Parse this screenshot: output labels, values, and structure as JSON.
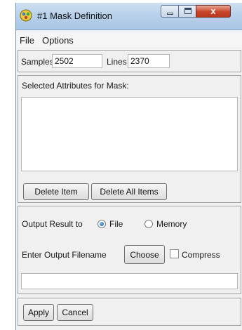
{
  "window": {
    "title": "#1 Mask Definition",
    "close_glyph": "x",
    "icons": {
      "app": "app-icon",
      "minimize": "minimize-icon",
      "maximize": "maximize-icon",
      "close": "close-icon"
    }
  },
  "menu": {
    "file": "File",
    "options": "Options"
  },
  "dims": {
    "samples_label": "Samples",
    "samples_value": "2502",
    "lines_label": "Lines",
    "lines_value": "2370"
  },
  "attributes": {
    "title": "Selected Attributes for Mask:",
    "items": [],
    "delete_item": "Delete Item",
    "delete_all": "Delete All Items"
  },
  "output": {
    "result_label": "Output Result to",
    "options": [
      {
        "label": "File",
        "selected": true
      },
      {
        "label": "Memory",
        "selected": false
      }
    ],
    "filename_label": "Enter Output Filename",
    "choose": "Choose",
    "compress_label": "Compress",
    "compress_checked": false,
    "filename_value": ""
  },
  "footer": {
    "apply": "Apply",
    "cancel": "Cancel"
  },
  "colors": {
    "titlebar": "#b9d1ea",
    "close_button": "#c8452a",
    "window_bg": "#f0f0f0"
  }
}
